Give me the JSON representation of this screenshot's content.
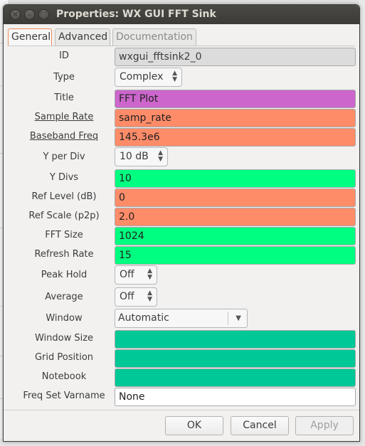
{
  "window": {
    "title": "Properties: WX GUI FFT Sink"
  },
  "tabs": [
    {
      "label": "General"
    },
    {
      "label": "Advanced"
    },
    {
      "label": "Documentation"
    }
  ],
  "params": [
    {
      "label": "ID",
      "value": "wxgui_fftsink2_0"
    },
    {
      "label": "Type",
      "value": "Complex"
    },
    {
      "label": "Title",
      "value": "FFT Plot"
    },
    {
      "label": "Sample Rate",
      "value": "samp_rate"
    },
    {
      "label": "Baseband Freq",
      "value": "145.3e6"
    },
    {
      "label": "Y per Div",
      "value": "10 dB"
    },
    {
      "label": "Y Divs",
      "value": "10"
    },
    {
      "label": "Ref Level (dB)",
      "value": "0"
    },
    {
      "label": "Ref Scale (p2p)",
      "value": "2.0"
    },
    {
      "label": "FFT Size",
      "value": "1024"
    },
    {
      "label": "Refresh Rate",
      "value": "15"
    },
    {
      "label": "Peak Hold",
      "value": "Off"
    },
    {
      "label": "Average",
      "value": "Off"
    },
    {
      "label": "Window",
      "value": "Automatic"
    },
    {
      "label": "Window Size",
      "value": ""
    },
    {
      "label": "Grid Position",
      "value": ""
    },
    {
      "label": "Notebook",
      "value": ""
    },
    {
      "label": "Freq Set Varname",
      "value": "None"
    }
  ],
  "colors": {
    "readonly": "#dcdcdc",
    "string": "#cc66cc",
    "float": "#ff8c69",
    "int": "#00ff80",
    "raw": "#00c896",
    "id_none": "#ffffff",
    "active_tab_border": "#f08c5a"
  },
  "buttons": {
    "ok": "OK",
    "cancel": "Cancel",
    "apply": "Apply"
  }
}
